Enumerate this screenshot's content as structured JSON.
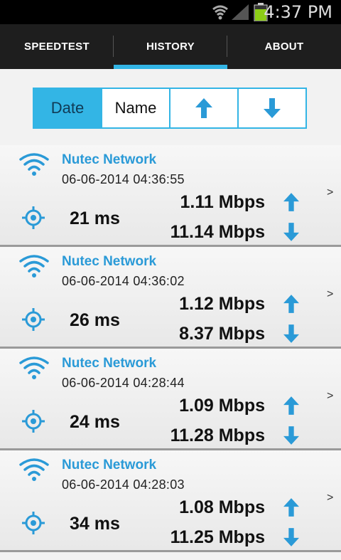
{
  "status_bar": {
    "time": "4:37 PM",
    "icons": [
      "wifi-icon",
      "signal-icon",
      "battery-icon"
    ]
  },
  "tabs": [
    {
      "label": "SPEEDTEST",
      "active": false
    },
    {
      "label": "HISTORY",
      "active": true
    },
    {
      "label": "ABOUT",
      "active": false
    }
  ],
  "sort": {
    "date_label": "Date",
    "name_label": "Name",
    "upload_icon": "arrow-up-icon",
    "download_icon": "arrow-down-icon",
    "active": "Date"
  },
  "colors": {
    "accent": "#33b5e5",
    "network_text": "#2a9ad7"
  },
  "history": [
    {
      "network": "Nutec Network",
      "date": "06-06-2014 04:36:55",
      "ping": "21 ms",
      "upload": "1.11 Mbps",
      "download": "11.14 Mbps"
    },
    {
      "network": "Nutec Network",
      "date": "06-06-2014 04:36:02",
      "ping": "26 ms",
      "upload": "1.12 Mbps",
      "download": "8.37 Mbps"
    },
    {
      "network": "Nutec Network",
      "date": "06-06-2014 04:28:44",
      "ping": "24 ms",
      "upload": "1.09 Mbps",
      "download": "11.28 Mbps"
    },
    {
      "network": "Nutec Network",
      "date": "06-06-2014 04:28:03",
      "ping": "34 ms",
      "upload": "1.08 Mbps",
      "download": "11.25 Mbps"
    }
  ],
  "row_chevron": ">"
}
